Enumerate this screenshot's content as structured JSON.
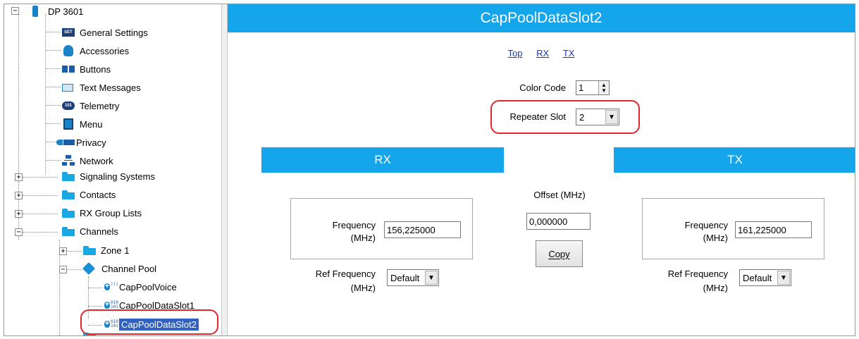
{
  "tree": {
    "root": "DP 3601",
    "items": [
      {
        "label": "General Settings",
        "icon": "settings-icon"
      },
      {
        "label": "Accessories",
        "icon": "accessories-icon"
      },
      {
        "label": "Buttons",
        "icon": "buttons-icon"
      },
      {
        "label": "Text Messages",
        "icon": "envelope-icon"
      },
      {
        "label": "Telemetry",
        "icon": "telemetry-icon"
      },
      {
        "label": "Menu",
        "icon": "menu-icon"
      },
      {
        "label": "Privacy",
        "icon": "key-icon"
      },
      {
        "label": "Network",
        "icon": "network-icon"
      },
      {
        "label": "Signaling Systems",
        "icon": "folder-icon"
      },
      {
        "label": "Contacts",
        "icon": "folder-icon"
      },
      {
        "label": "RX Group Lists",
        "icon": "folder-icon"
      },
      {
        "label": "Channels",
        "icon": "folder-open-icon"
      },
      {
        "label": "Zone 1",
        "icon": "folder-icon"
      },
      {
        "label": "Channel Pool",
        "icon": "cube-icon"
      },
      {
        "label": "CapPoolVoice",
        "icon": "voice-channel-icon"
      },
      {
        "label": "CapPoolDataSlot1",
        "icon": "data-channel-icon"
      },
      {
        "label": "CapPoolDataSlot2",
        "icon": "data-channel-icon"
      }
    ],
    "glyph_settings": "SET",
    "glyph_telemetry": "101",
    "selected": "CapPoolDataSlot2"
  },
  "main": {
    "title": "CapPoolDataSlot2",
    "links": [
      "Top",
      "RX",
      "TX"
    ],
    "color_code_label": "Color Code",
    "color_code_value": "1",
    "repeater_slot_label": "Repeater Slot",
    "repeater_slot_value": "2",
    "rx_title": "RX",
    "tx_title": "TX",
    "offset_label": "Offset (MHz)",
    "offset_value": "0,000000",
    "copy_label": "Copy",
    "rx": {
      "freq_label_1": "Frequency",
      "freq_label_2": "(MHz)",
      "freq_value": "156,225000",
      "ref_label_1": "Ref Frequency",
      "ref_label_2": "(MHz)",
      "ref_value": "Default"
    },
    "tx": {
      "freq_label_1": "Frequency",
      "freq_label_2": "(MHz)",
      "freq_value": "161,225000",
      "ref_label_1": "Ref Frequency",
      "ref_label_2": "(MHz)",
      "ref_value": "Default"
    }
  },
  "colors": {
    "accent": "#14a5ea",
    "highlight_ring": "#e0262f",
    "selection": "#3161c1"
  }
}
